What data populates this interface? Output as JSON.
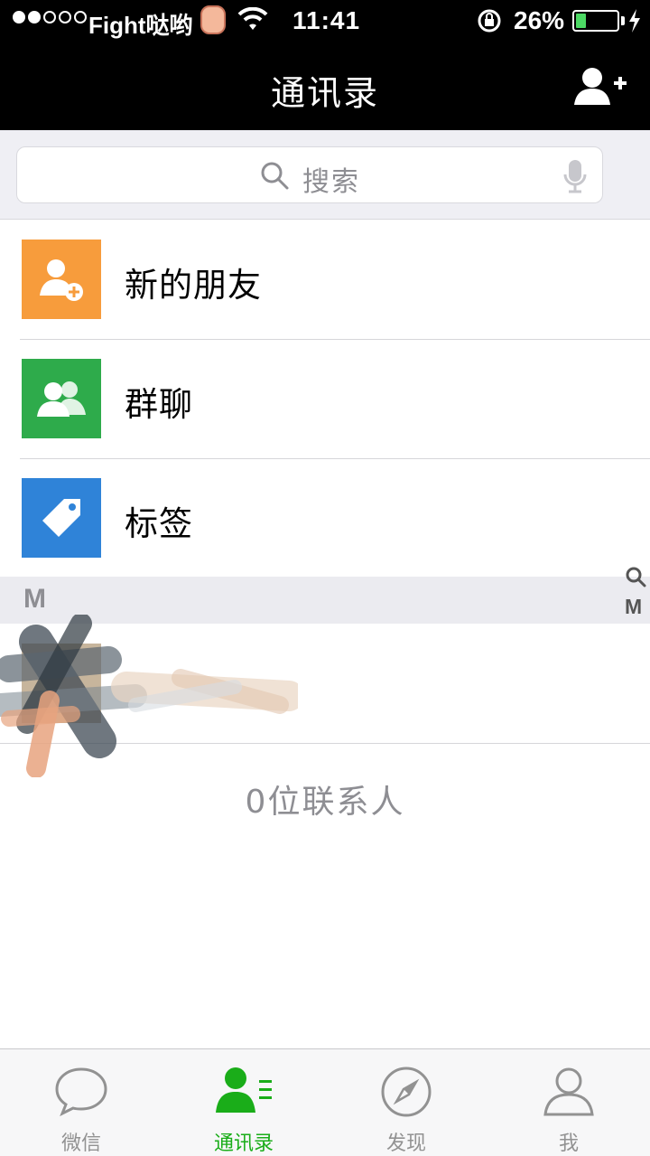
{
  "status_bar": {
    "carrier": "Fight哒哟",
    "time": "11:41",
    "battery_percent": "26%",
    "battery_level": 0.26,
    "signal_bars_filled": 2,
    "signal_bars_total": 5
  },
  "header": {
    "title": "通讯录",
    "add_contact_icon": "add-user-icon"
  },
  "search": {
    "placeholder": "搜索"
  },
  "features": [
    {
      "label": "新的朋友",
      "icon": "new-friend-icon",
      "color": "#f79c3c"
    },
    {
      "label": "群聊",
      "icon": "group-chat-icon",
      "color": "#2eab4b"
    },
    {
      "label": "标签",
      "icon": "tag-icon",
      "color": "#2f83d8"
    }
  ],
  "contacts_section": {
    "letter": "M"
  },
  "index_bar": {
    "letters": [
      "M"
    ]
  },
  "footer": {
    "count_text": "0位联系人"
  },
  "tabs": [
    {
      "label": "微信",
      "icon": "chat-bubble-icon",
      "active": false
    },
    {
      "label": "通讯录",
      "icon": "contacts-icon",
      "active": true
    },
    {
      "label": "发现",
      "icon": "compass-icon",
      "active": false
    },
    {
      "label": "我",
      "icon": "profile-icon",
      "active": false
    }
  ],
  "colors": {
    "active_tab": "#1aad19",
    "inactive_tab": "#929292",
    "header_bg": "#000000"
  }
}
